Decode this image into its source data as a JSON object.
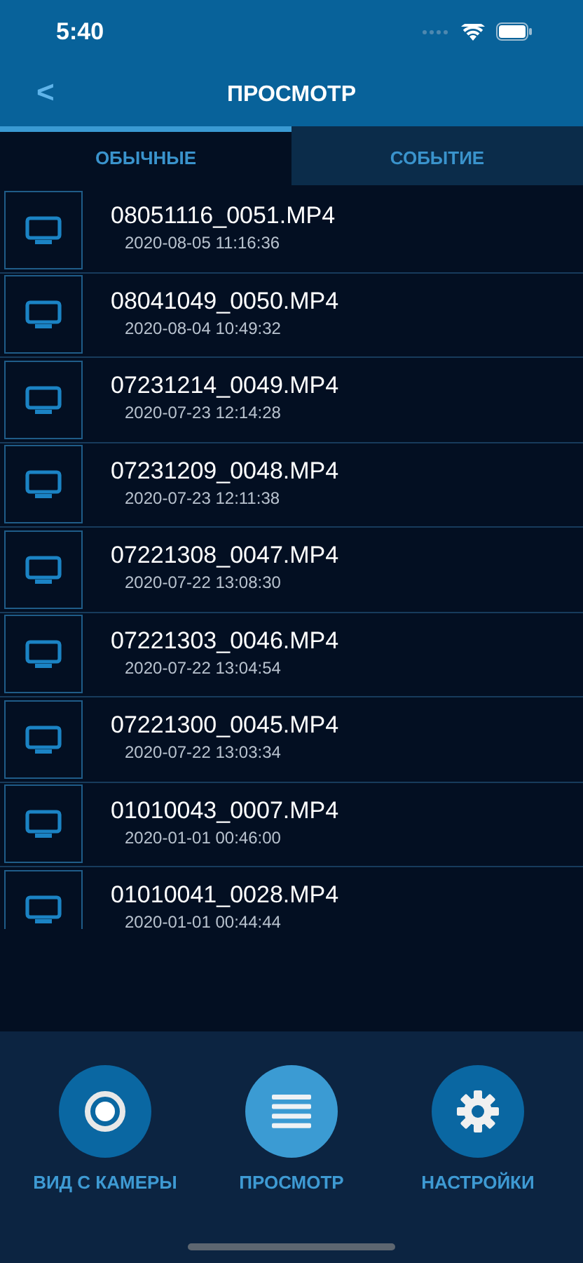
{
  "status_bar": {
    "time": "5:40"
  },
  "header": {
    "back": "<",
    "title": "ПРОСМОТР"
  },
  "tabs": [
    {
      "label": "ОБЫЧНЫЕ",
      "selected": true
    },
    {
      "label": "СОБЫТИЕ",
      "selected": false
    }
  ],
  "files": [
    {
      "name": "08051116_0051.MP4",
      "date": "2020-08-05 11:16:36"
    },
    {
      "name": "08041049_0050.MP4",
      "date": "2020-08-04 10:49:32"
    },
    {
      "name": "07231214_0049.MP4",
      "date": "2020-07-23 12:14:28"
    },
    {
      "name": "07231209_0048.MP4",
      "date": "2020-07-23 12:11:38"
    },
    {
      "name": "07221308_0047.MP4",
      "date": "2020-07-22 13:08:30"
    },
    {
      "name": "07221303_0046.MP4",
      "date": "2020-07-22 13:04:54"
    },
    {
      "name": "07221300_0045.MP4",
      "date": "2020-07-22 13:03:34"
    },
    {
      "name": "01010043_0007.MP4",
      "date": "2020-01-01 00:46:00"
    },
    {
      "name": "01010041_0028.MP4",
      "date": "2020-01-01 00:44:44"
    }
  ],
  "bottom_nav": [
    {
      "kind": "camera",
      "label": "ВИД С КАМЕРЫ",
      "selected": false
    },
    {
      "kind": "list",
      "label": "ПРОСМОТР",
      "selected": true
    },
    {
      "kind": "settings",
      "label": "НАСТРОЙКИ",
      "selected": false
    }
  ]
}
